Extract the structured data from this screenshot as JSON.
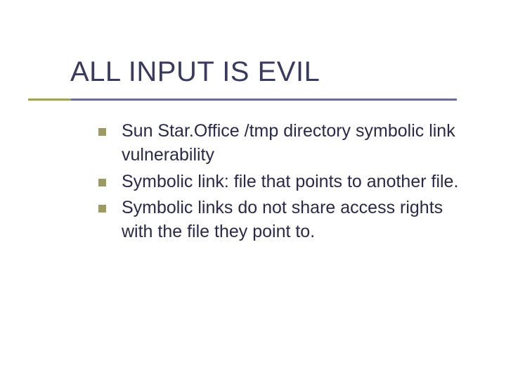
{
  "title": "ALL INPUT IS EVIL",
  "bullets": [
    "Sun Star.Office /tmp directory symbolic link vulnerability",
    "Symbolic link: file that points to another file.",
    "Symbolic links do not share access rights with the file they point to."
  ]
}
